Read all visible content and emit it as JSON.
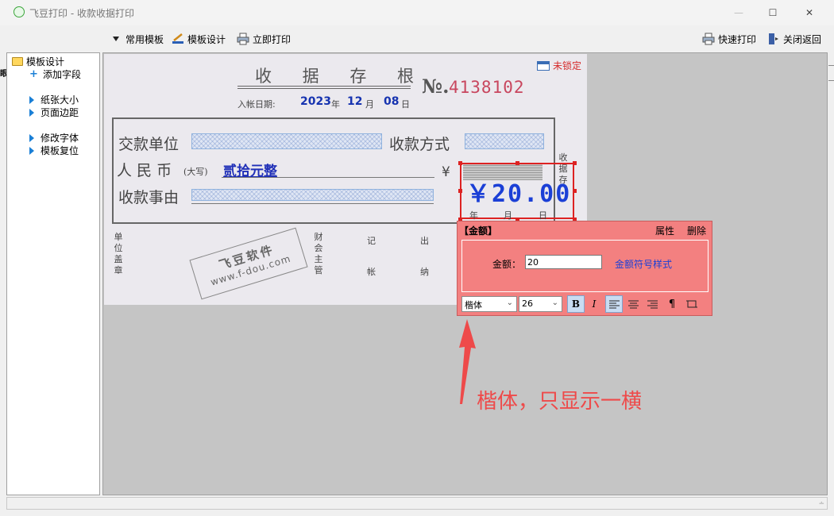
{
  "window": {
    "title": "飞豆打印 - 收款收据打印",
    "minimize": "—",
    "maximize": "☐",
    "close": "✕"
  },
  "toolbar": {
    "common_templates": "常用模板",
    "template_design": "模板设计",
    "print_now": "立即打印",
    "quick_print": "快速打印",
    "close_return": "关闭返回"
  },
  "sidebar": {
    "root": "模板设计",
    "items": [
      {
        "label": "添加字段",
        "icon": "plus-icon"
      },
      {
        "label": "纸张大小",
        "icon": "triangle-right-icon"
      },
      {
        "label": "页面边距",
        "icon": "triangle-right-icon"
      },
      {
        "label": "修改字体",
        "icon": "triangle-right-icon"
      },
      {
        "label": "模板复位",
        "icon": "triangle-right-icon"
      }
    ]
  },
  "receipt": {
    "title": "收 据 存 根",
    "no_label": "№.",
    "no_value": "4138102",
    "date_label": "入帐日期:",
    "year": "2023",
    "year_unit": "年",
    "month": "12",
    "month_unit": "月",
    "day": "08",
    "day_unit": "日",
    "payer_label": "交款单位",
    "method_label": "收款方式",
    "rmb_label": "人 民 币",
    "rmb_sub": "(大写)",
    "amount_words": "贰拾元整",
    "yen_sign": "¥",
    "reason_label": "收款事由",
    "amount_display": "￥20.00",
    "date_y": "年",
    "date_m": "月",
    "date_d": "日",
    "side_vertical": "收据存",
    "seal_label": "单位盖章",
    "finance_label": "财会主管",
    "book_1": "记",
    "book_2": "帐",
    "cash_1": "出",
    "cash_2": "纳",
    "stamp_line1": "飞豆软件",
    "stamp_line2": "www.f-dou.com",
    "lock_status": "未锁定"
  },
  "property_panel": {
    "title": "【金额】",
    "attr": "属性",
    "delete": "删除",
    "amount_label": "金额：",
    "amount_value": "20",
    "symbol_style": "金额符号样式",
    "font_family": "楷体",
    "font_size": "26",
    "bold": "B",
    "italic": "I"
  },
  "annotation": {
    "text": "楷体，只显示一横",
    "color": "#ee4a4a"
  },
  "colors": {
    "amount_blue": "#1b3fd6",
    "selection_red": "#dd2222",
    "panel_bg": "#f38080",
    "receipt_no_red": "#c8465e"
  }
}
